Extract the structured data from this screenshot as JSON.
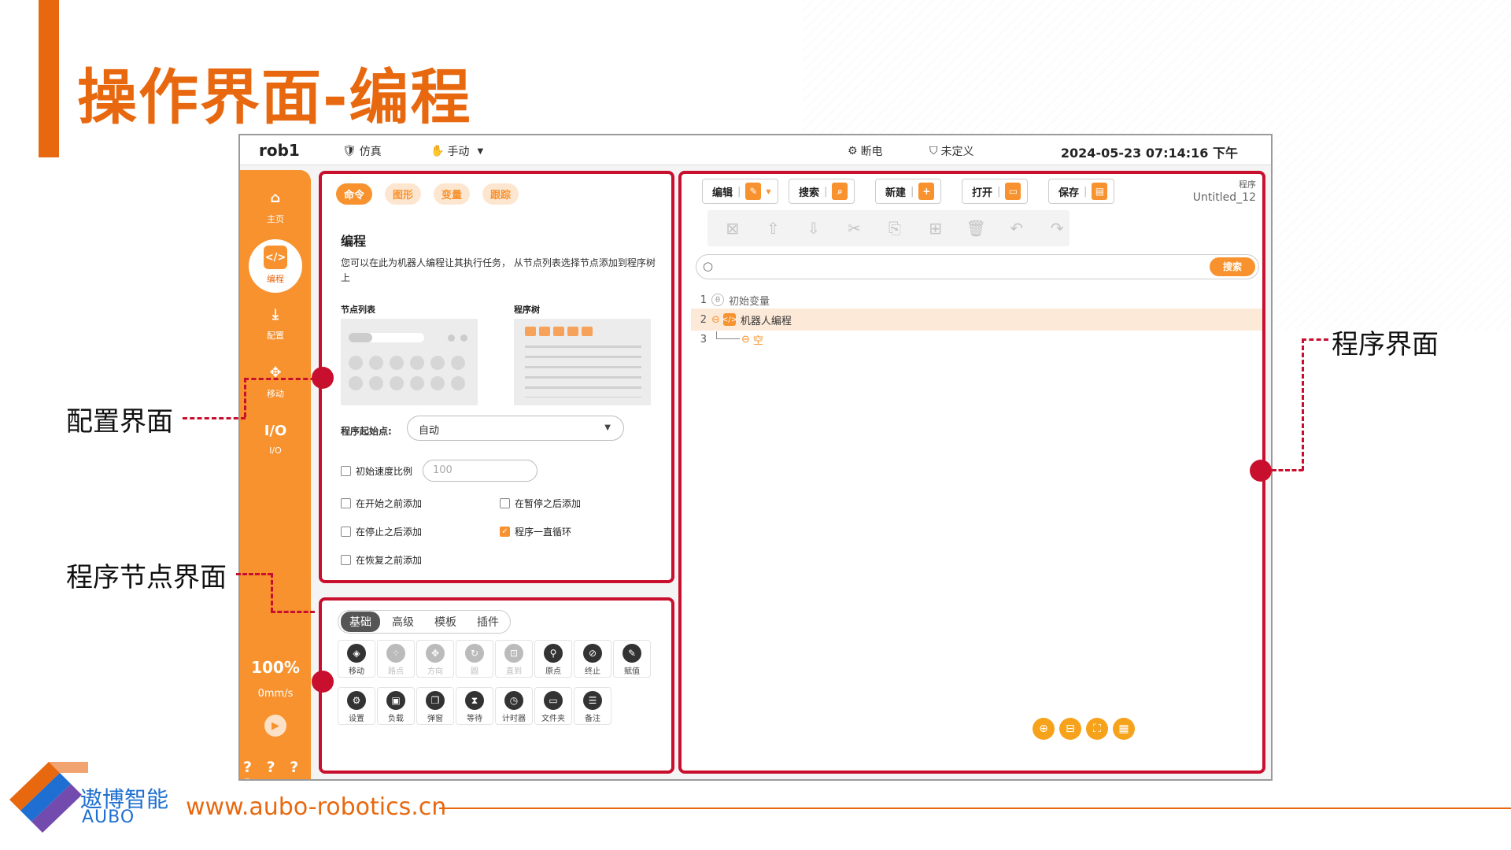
{
  "slide": {
    "title": "操作界面-编程",
    "callouts": {
      "config": "配置界面",
      "nodes": "程序节点界面",
      "program": "程序界面"
    },
    "brand_cn": "遨博智能",
    "brand_en": "AUBO",
    "url": "www.aubo-robotics.cn"
  },
  "colors": {
    "accent": "#e8680f",
    "sidebar": "#f7922e",
    "callout": "#c8102e",
    "brand_blue": "#1e6fd1"
  },
  "topbar": {
    "robot": "rob1",
    "sim": "仿真",
    "mode": "手动",
    "power": "断电",
    "safety": "未定义",
    "datetime": "2024-05-23 07:14:16 下午"
  },
  "sidebar": {
    "items": [
      {
        "label": "主页",
        "icon": "home-icon"
      },
      {
        "label": "编程",
        "icon": "code-icon"
      },
      {
        "label": "配置",
        "icon": "config-icon"
      },
      {
        "label": "移动",
        "icon": "move-icon"
      },
      {
        "label": "I/O",
        "icon": "io-icon"
      }
    ],
    "speed_percent": "100%",
    "speed_value": "0mm/s",
    "bottom": "? ? ? ?"
  },
  "config": {
    "tabs": [
      "命令",
      "图形",
      "变量",
      "跟踪"
    ],
    "heading": "编程",
    "description": "您可以在此为机器人编程让其执行任务， 从节点列表选择节点添加到程序树上",
    "node_list_label": "节点列表",
    "program_tree_label": "程序树",
    "start_point_label": "程序起始点:",
    "start_point_value": "自动",
    "init_speed_label": "初始速度比例",
    "init_speed_placeholder": "100",
    "checkboxes": [
      {
        "label": "在开始之前添加",
        "checked": false
      },
      {
        "label": "在暂停之后添加",
        "checked": false
      },
      {
        "label": "在停止之后添加",
        "checked": false
      },
      {
        "label": "程序一直循环",
        "checked": true
      },
      {
        "label": "在恢复之前添加",
        "checked": false
      }
    ]
  },
  "nodes": {
    "tabs": [
      "基础",
      "高级",
      "模板",
      "插件"
    ],
    "row1": [
      {
        "label": "移动",
        "icon": "move-node-icon",
        "enabled": true
      },
      {
        "label": "路点",
        "icon": "waypoint-icon",
        "enabled": false
      },
      {
        "label": "方向",
        "icon": "direction-icon",
        "enabled": false
      },
      {
        "label": "圆",
        "icon": "circle-icon",
        "enabled": false
      },
      {
        "label": "直到",
        "icon": "until-icon",
        "enabled": false
      },
      {
        "label": "原点",
        "icon": "origin-icon",
        "enabled": true
      },
      {
        "label": "终止",
        "icon": "stop-icon",
        "enabled": true
      },
      {
        "label": "赋值",
        "icon": "assign-icon",
        "enabled": true
      }
    ],
    "row2": [
      {
        "label": "设置",
        "icon": "settings-icon",
        "enabled": true
      },
      {
        "label": "负载",
        "icon": "payload-icon",
        "enabled": true
      },
      {
        "label": "弹窗",
        "icon": "popup-icon",
        "enabled": true
      },
      {
        "label": "等待",
        "icon": "wait-icon",
        "enabled": true
      },
      {
        "label": "计时器",
        "icon": "timer-icon",
        "enabled": true
      },
      {
        "label": "文件夹",
        "icon": "folder-icon",
        "enabled": true
      },
      {
        "label": "备注",
        "icon": "comment-icon",
        "enabled": true
      }
    ]
  },
  "program": {
    "toolbar": [
      "编辑",
      "搜索",
      "新建",
      "打开",
      "保存"
    ],
    "program_label": "程序",
    "program_name": "Untitled_12",
    "search_button": "搜索",
    "search_placeholder": "",
    "tree": [
      {
        "num": "1",
        "label": "初始变量"
      },
      {
        "num": "2",
        "label": "机器人编程"
      },
      {
        "num": "3",
        "label": "空"
      }
    ]
  }
}
